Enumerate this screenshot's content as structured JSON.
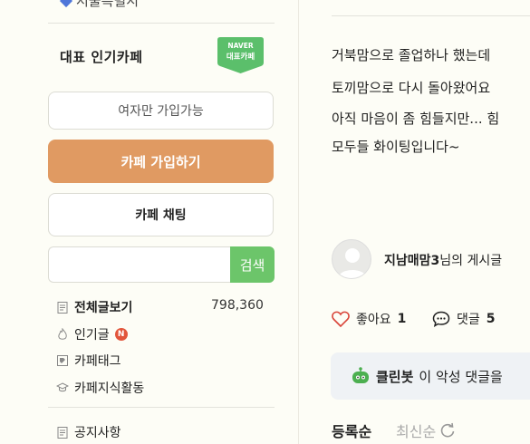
{
  "sidebar": {
    "region": "서울특별시",
    "rep_label": "대표 인기카페",
    "naver_badge": {
      "line1": "NAVER",
      "line2": "대표카페"
    },
    "women_only": "여자만 가입가능",
    "join_button": "카페 가입하기",
    "chat_button": "카페 채팅",
    "search": {
      "placeholder": "",
      "button": "검색"
    },
    "menu": {
      "all_posts": "전체글보기",
      "all_count": "798,360",
      "popular": "인기글",
      "popular_badge": "N",
      "tags": "카페태그",
      "knowledge": "카페지식활동",
      "notice": "공지사항"
    }
  },
  "post": {
    "lines": [
      "거북맘으로 졸업하나 했는데",
      "토끼맘으로 다시 돌아왔어요",
      "아직 마음이 좀 힘들지만... 힘",
      "모두들 화이팅입니다~"
    ],
    "author_name": "지남매맘3",
    "author_suffix": "님의 게시글",
    "like_label": "좋아요",
    "like_count": "1",
    "comment_label": "댓글",
    "comment_count": "5",
    "cleanbot_name": "클린봇",
    "cleanbot_text": "이 악성 댓글을",
    "sort_registered": "등록순",
    "sort_latest": "최신순"
  },
  "colors": {
    "join": "#e09a62",
    "search": "#6cc56a",
    "naver_green": "#5bbf6b",
    "badge_red": "#e2553b"
  }
}
